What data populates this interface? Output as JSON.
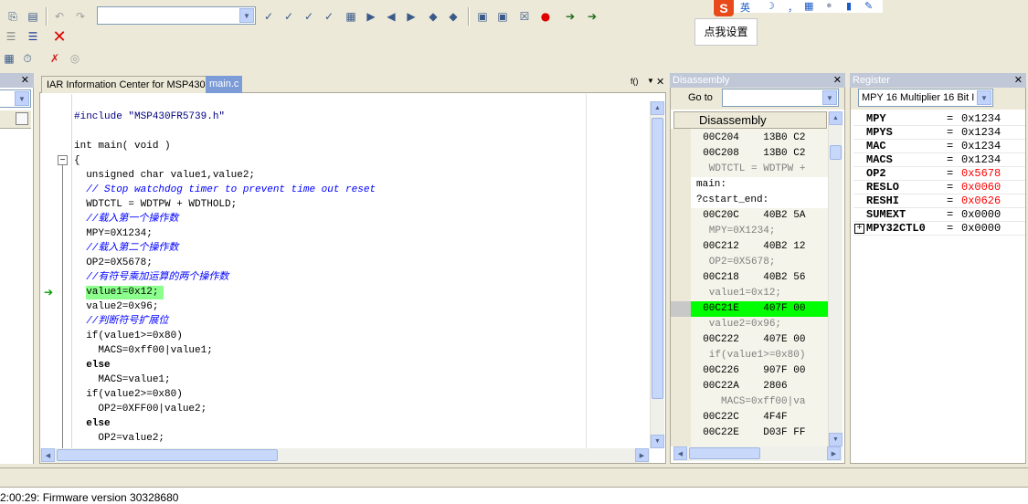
{
  "toolbar": {
    "find_combo_value": "",
    "tooltip_label": "点我设置"
  },
  "editor": {
    "tabs": [
      {
        "label": "IAR Information Center for MSP430",
        "active": false
      },
      {
        "label": "main.c",
        "active": true
      }
    ],
    "func_button": "f()",
    "lines": [
      {
        "kind": "code",
        "text": "#include \"MSP430FR5739.h\""
      },
      {
        "kind": "code",
        "text": "int main( void )"
      },
      {
        "kind": "code",
        "text": "{"
      },
      {
        "kind": "code",
        "text": "  unsigned char value1,value2;"
      },
      {
        "kind": "comment",
        "text": "  // Stop watchdog timer to prevent time out reset"
      },
      {
        "kind": "code",
        "text": "  WDTCTL = WDTPW + WDTHOLD;"
      },
      {
        "kind": "comment",
        "text": "  //载入第一个操作数"
      },
      {
        "kind": "code",
        "text": "  MPY=0X1234;"
      },
      {
        "kind": "comment",
        "text": "  //载入第二个操作数"
      },
      {
        "kind": "code",
        "text": "  OP2=0X5678;"
      },
      {
        "kind": "comment",
        "text": "  //有符号乘加运算的两个操作数"
      },
      {
        "kind": "code",
        "text": "  value1=0x12;"
      },
      {
        "kind": "code",
        "text": "  value2=0x96;"
      },
      {
        "kind": "comment",
        "text": "  //判断符号扩展位"
      },
      {
        "kind": "code",
        "text": "  if(value1>=0x80)"
      },
      {
        "kind": "code",
        "text": "    MACS=0xff00|value1;"
      },
      {
        "kind": "code",
        "text": "  else"
      },
      {
        "kind": "code",
        "text": "    MACS=value1;"
      },
      {
        "kind": "code",
        "text": "  if(value2>=0x80)"
      },
      {
        "kind": "code",
        "text": "    OP2=0XFF00|value2;"
      },
      {
        "kind": "code",
        "text": "  else"
      },
      {
        "kind": "code",
        "text": "    OP2=value2;"
      }
    ]
  },
  "disassembly": {
    "title": "Disassembly",
    "goto_label": "Go to",
    "goto_value": "",
    "header": "Disassembly",
    "rows": [
      {
        "text": "  00C204    13B0 C2",
        "kind": "asm"
      },
      {
        "text": "  00C208    13B0 C2",
        "kind": "asm"
      },
      {
        "text": "   WDTCTL = WDTPW +",
        "kind": "src"
      },
      {
        "text": "main:",
        "kind": "label"
      },
      {
        "text": "?cstart_end:",
        "kind": "label"
      },
      {
        "text": "  00C20C    40B2 5A",
        "kind": "asm"
      },
      {
        "text": "   MPY=0X1234;",
        "kind": "src"
      },
      {
        "text": "  00C212    40B2 12",
        "kind": "asm"
      },
      {
        "text": "   OP2=0X5678;",
        "kind": "src"
      },
      {
        "text": "  00C218    40B2 56",
        "kind": "asm"
      },
      {
        "text": "   value1=0x12;",
        "kind": "src"
      },
      {
        "text": "  00C21E    407F 00",
        "kind": "current"
      },
      {
        "text": "   value2=0x96;",
        "kind": "src"
      },
      {
        "text": "  00C222    407E 00",
        "kind": "asm"
      },
      {
        "text": "   if(value1>=0x80)",
        "kind": "src"
      },
      {
        "text": "  00C226    907F 00",
        "kind": "asm"
      },
      {
        "text": "  00C22A    2806",
        "kind": "asm"
      },
      {
        "text": "     MACS=0xff00|va",
        "kind": "src"
      },
      {
        "text": "  00C22C    4F4F",
        "kind": "asm"
      },
      {
        "text": "  00C22E    D03F FF",
        "kind": "asm"
      }
    ]
  },
  "register": {
    "title": "Register",
    "group": "MPY 16  Multiplier  16 Bit I",
    "rows": [
      {
        "name": "MPY",
        "value": "0x1234",
        "changed": false,
        "expand": false
      },
      {
        "name": "MPYS",
        "value": "0x1234",
        "changed": false,
        "expand": false
      },
      {
        "name": "MAC",
        "value": "0x1234",
        "changed": false,
        "expand": false
      },
      {
        "name": "MACS",
        "value": "0x1234",
        "changed": false,
        "expand": false
      },
      {
        "name": "OP2",
        "value": "0x5678",
        "changed": true,
        "expand": false
      },
      {
        "name": "RESLO",
        "value": "0x0060",
        "changed": true,
        "expand": false
      },
      {
        "name": "RESHI",
        "value": "0x0626",
        "changed": true,
        "expand": false
      },
      {
        "name": "SUMEXT",
        "value": "0x0000",
        "changed": false,
        "expand": false
      },
      {
        "name": "MPY32CTL0",
        "value": "0x0000",
        "changed": false,
        "expand": true
      }
    ]
  },
  "status": {
    "message": "2:00:29: Firmware version 30328680"
  },
  "colors": {
    "current_line": "#00ff00",
    "changed_value": "#ff0000",
    "comment": "#0000ff",
    "title_inactive": "#c0c8d8"
  }
}
